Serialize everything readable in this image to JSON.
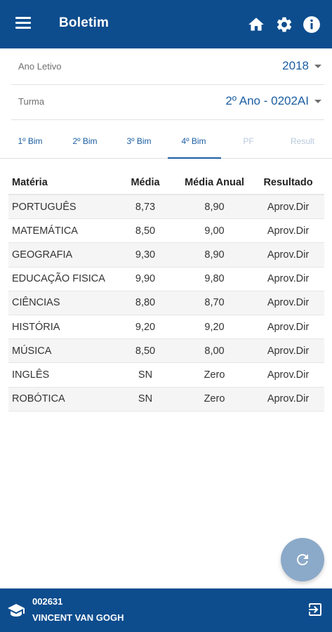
{
  "appbar": {
    "title": "Boletim",
    "icons": [
      "menu-icon",
      "home-icon",
      "gear-icon",
      "info-icon"
    ]
  },
  "filters": {
    "ano_letivo": {
      "label": "Ano Letivo",
      "value": "2018"
    },
    "turma": {
      "label": "Turma",
      "value": "2º Ano - 0202AI"
    }
  },
  "tabs": [
    {
      "label": "1º Bim",
      "state": "enabled"
    },
    {
      "label": "2º Bim",
      "state": "enabled"
    },
    {
      "label": "3º Bim",
      "state": "enabled"
    },
    {
      "label": "4º Bim",
      "state": "active"
    },
    {
      "label": "PF",
      "state": "disabled"
    },
    {
      "label": "Result",
      "state": "disabled"
    }
  ],
  "grades": {
    "headers": [
      "Matéria",
      "Média",
      "Média Anual",
      "Resultado"
    ],
    "rows": [
      [
        "PORTUGUÊS",
        "8,73",
        "8,90",
        "Aprov.Dir"
      ],
      [
        "MATEMÁTICA",
        "8,50",
        "9,00",
        "Aprov.Dir"
      ],
      [
        "GEOGRAFIA",
        "9,30",
        "8,90",
        "Aprov.Dir"
      ],
      [
        "EDUCAÇÃO FISICA",
        "9,90",
        "9,80",
        "Aprov.Dir"
      ],
      [
        "CIÊNCIAS",
        "8,80",
        "8,70",
        "Aprov.Dir"
      ],
      [
        "HISTÓRIA",
        "9,20",
        "9,20",
        "Aprov.Dir"
      ],
      [
        "MÚSICA",
        "8,50",
        "8,00",
        "Aprov.Dir"
      ],
      [
        "INGLÊS",
        "SN",
        "Zero",
        "Aprov.Dir"
      ],
      [
        "ROBÓTICA",
        "SN",
        "Zero",
        "Aprov.Dir"
      ]
    ]
  },
  "fab": {
    "icon": "refresh-icon"
  },
  "student": {
    "id": "002631",
    "name": "VINCENT VAN GOGH",
    "icons": [
      "graduation-cap-icon",
      "logout-icon"
    ]
  },
  "colors": {
    "primary": "#0d4d8e",
    "accent_text": "#1b5ea3",
    "fab": "#8ba9c9"
  }
}
